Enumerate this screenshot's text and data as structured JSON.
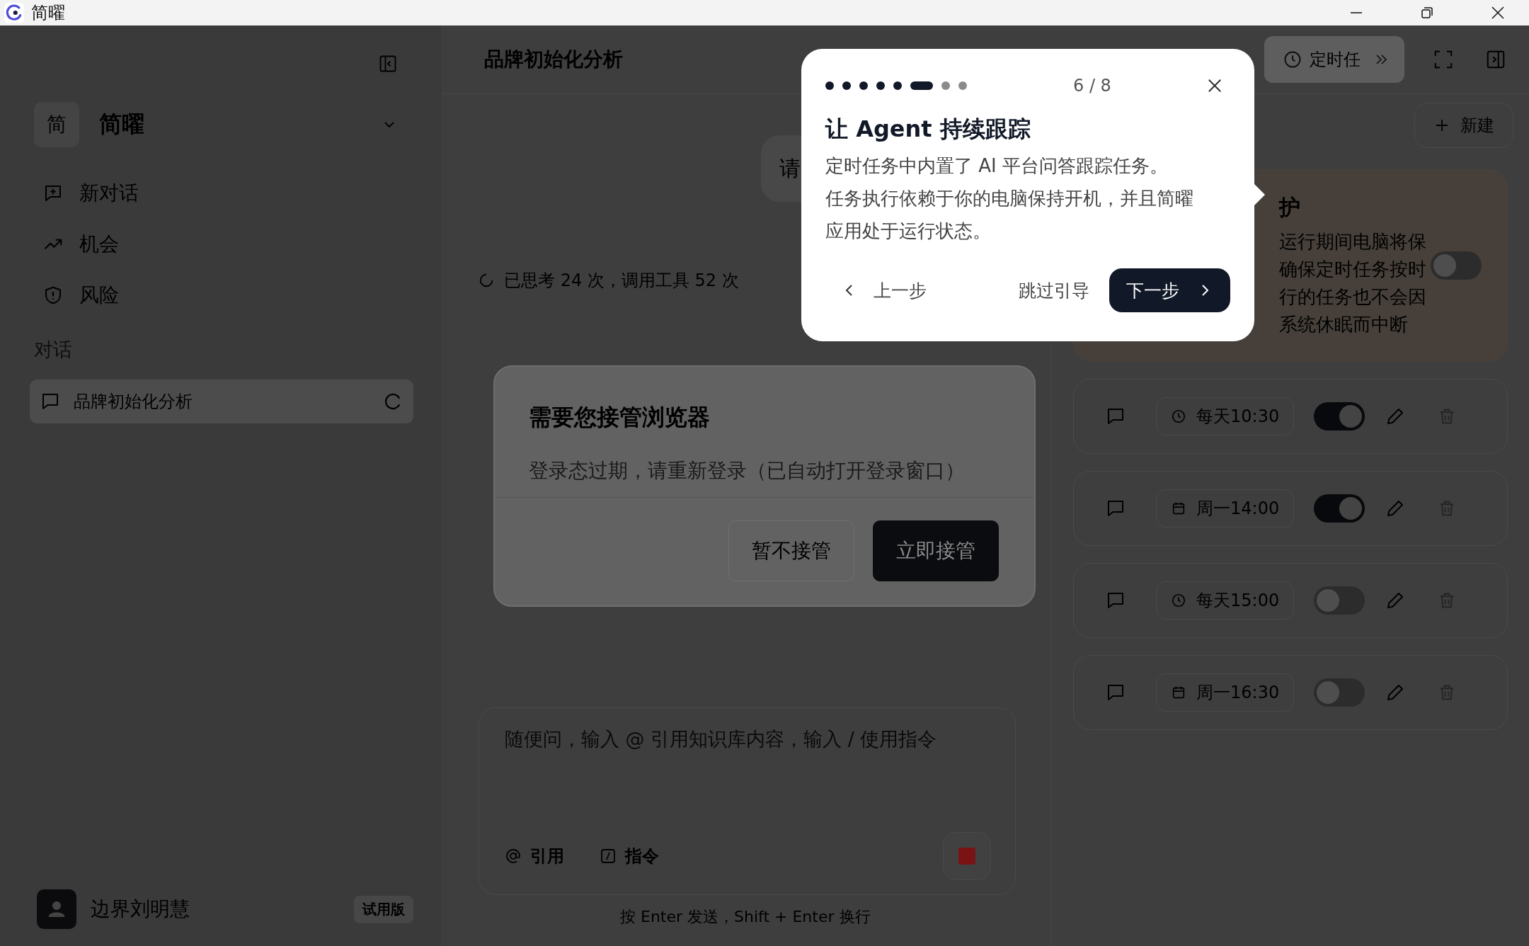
{
  "window": {
    "title": "简曜"
  },
  "sidebar": {
    "workspace": {
      "initial": "简",
      "name": "简曜"
    },
    "nav": [
      {
        "label": "新对话",
        "kind": "new-chat"
      },
      {
        "label": "机会",
        "kind": "trend"
      },
      {
        "label": "风险",
        "kind": "shield"
      }
    ],
    "section": "对话",
    "conversations": [
      {
        "title": "品牌初始化分析",
        "loading": true,
        "selected": true
      }
    ],
    "user": {
      "name": "边界刘明慧",
      "badge": "试用版"
    }
  },
  "header": {
    "title": "品牌初始化分析",
    "scheduled_button": "定时任"
  },
  "chat": {
    "user_message": "请",
    "status": "已思考 24 次，调用工具 52 次",
    "takeover_card": {
      "title": "需要您接管浏览器",
      "message": "登录态过期，请重新登录（已自动打开登录窗口）",
      "buttons": [
        {
          "label": "暂不接管",
          "kind": "secondary"
        },
        {
          "label": "立即接管",
          "kind": "primary"
        }
      ]
    },
    "input": {
      "placeholder": "随便问，输入 @ 引用知识库内容，输入 / 使用指令",
      "tools": [
        {
          "label": "引用",
          "kind": "at"
        },
        {
          "label": "指令",
          "kind": "slash"
        }
      ]
    },
    "hint": "按 Enter 发送，Shift + Enter 换行"
  },
  "tasks_panel": {
    "new_button": "新建",
    "keep_awake": {
      "title": "护",
      "lines": [
        "运行期间电脑将保",
        "确保定时任务按时",
        "行的任务也不会因",
        "系统休眠而中断"
      ],
      "on": false
    },
    "tasks": [
      {
        "schedule": "每天10:30",
        "kind": "daily",
        "on": true
      },
      {
        "schedule": "周一14:00",
        "kind": "weekly",
        "on": true
      },
      {
        "schedule": "每天15:00",
        "kind": "daily",
        "on": false
      },
      {
        "schedule": "周一16:30",
        "kind": "weekly",
        "on": false
      }
    ]
  },
  "tour": {
    "dots": [
      {
        "kind": "done"
      },
      {
        "kind": "done"
      },
      {
        "kind": "done"
      },
      {
        "kind": "done"
      },
      {
        "kind": "done"
      },
      {
        "kind": "current"
      },
      {
        "kind": "upcoming"
      },
      {
        "kind": "upcoming"
      }
    ],
    "counter": "6 / 8",
    "title": "让 Agent 持续跟踪",
    "body": [
      "定时任务中内置了 AI 平台问答跟踪任务。",
      "任务执行依赖于你的电脑保持开机，并且简曜",
      "应用处于运行状态。"
    ],
    "prev": "上一步",
    "skip": "跳过引导",
    "next": "下一步"
  }
}
